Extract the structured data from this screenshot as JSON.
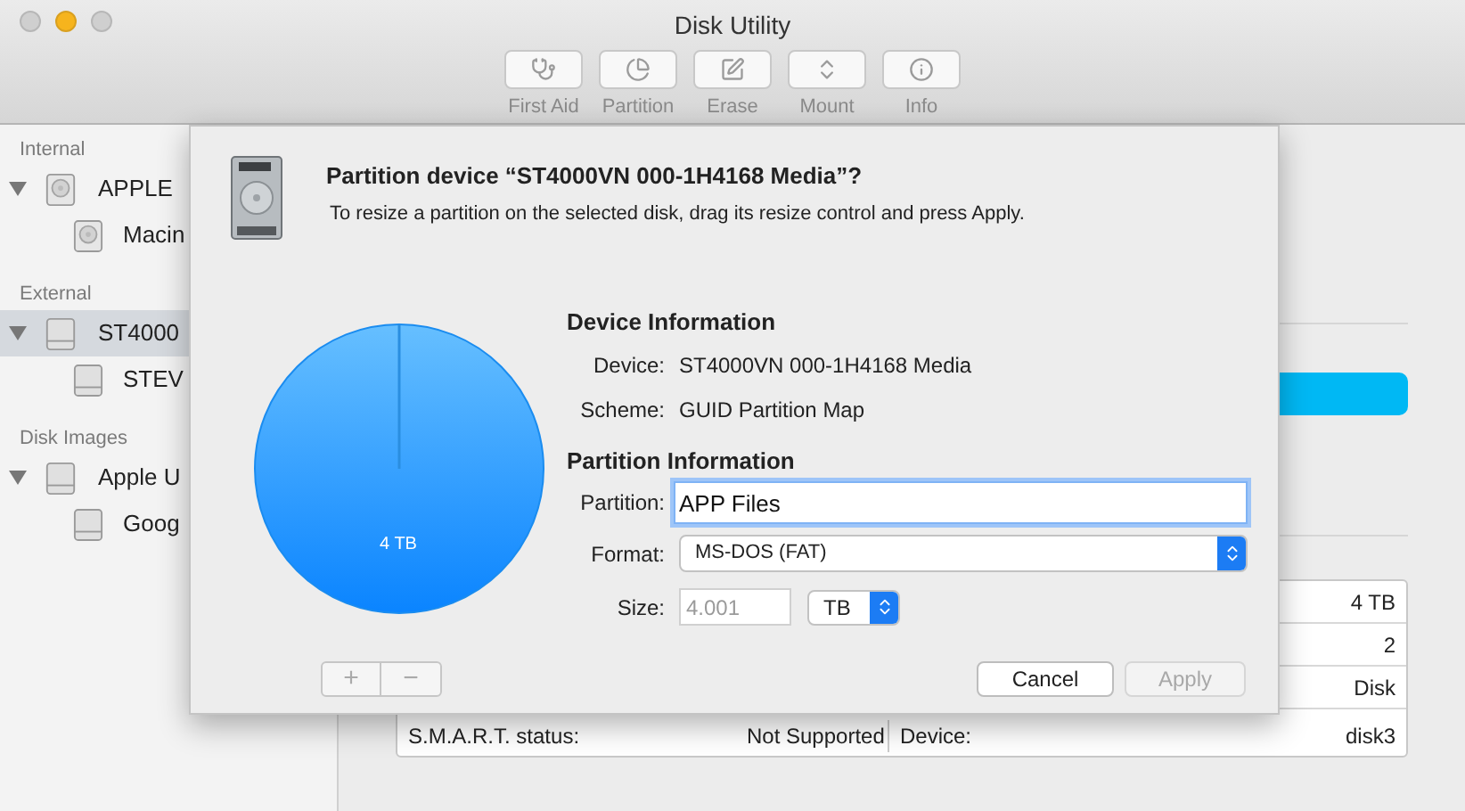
{
  "window": {
    "title": "Disk Utility"
  },
  "toolbar": [
    {
      "label": "First Aid",
      "kind": "firstaid",
      "disabled": true
    },
    {
      "label": "Partition",
      "kind": "partition",
      "disabled": true
    },
    {
      "label": "Erase",
      "kind": "erase",
      "disabled": true
    },
    {
      "label": "Mount",
      "kind": "mount",
      "disabled": true
    },
    {
      "label": "Info",
      "kind": "info",
      "disabled": true
    }
  ],
  "sidebar": {
    "sections": [
      {
        "title": "Internal",
        "items": [
          {
            "label": "APPLE",
            "kind": "internal",
            "selected": false,
            "expanded": true,
            "children": [
              {
                "label": "Macin",
                "kind": "internal",
                "selected": false
              }
            ]
          }
        ]
      },
      {
        "title": "External",
        "items": [
          {
            "label": "ST4000",
            "kind": "external",
            "selected": true,
            "expanded": true,
            "children": [
              {
                "label": "STEV",
                "kind": "external",
                "selected": false
              }
            ]
          }
        ]
      },
      {
        "title": "Disk Images",
        "items": [
          {
            "label": "Apple U",
            "kind": "external",
            "selected": false,
            "expanded": true,
            "children": [
              {
                "label": "Goog",
                "kind": "external",
                "selected": false
              }
            ]
          }
        ]
      }
    ]
  },
  "info_table": {
    "rows": [
      {
        "value": "4 TB"
      },
      {
        "value": "2"
      },
      {
        "value": "Disk"
      }
    ],
    "last_row": {
      "label": "S.M.A.R.T. status:",
      "value": "Not Supported",
      "label_2": "Device:",
      "value_2": "disk3"
    }
  },
  "dialog": {
    "title": "Partition device “ST4000VN 000-1H4168 Media”?",
    "message": "To resize a partition on the selected disk, drag its resize control and press Apply.",
    "pie_label": "4 TB",
    "device_heading": "Device Information",
    "device_rows": [
      {
        "label": "Device:",
        "value": "ST4000VN 000-1H4168 Media"
      },
      {
        "label": "Scheme:",
        "value": "GUID Partition Map"
      }
    ],
    "partition_heading": "Partition Information",
    "partition": {
      "label": "Partition:",
      "value": "APP Files",
      "focused": true
    },
    "format": {
      "label": "Format:",
      "value": "MS-DOS (FAT)"
    },
    "size": {
      "label": "Size:",
      "value": "4.001",
      "disabled": true,
      "unit": "TB"
    },
    "add_button": "+",
    "remove_button": "−",
    "buttons": [
      {
        "label": "Cancel",
        "disabled": false
      },
      {
        "label": "Apply",
        "disabled": true
      }
    ]
  }
}
